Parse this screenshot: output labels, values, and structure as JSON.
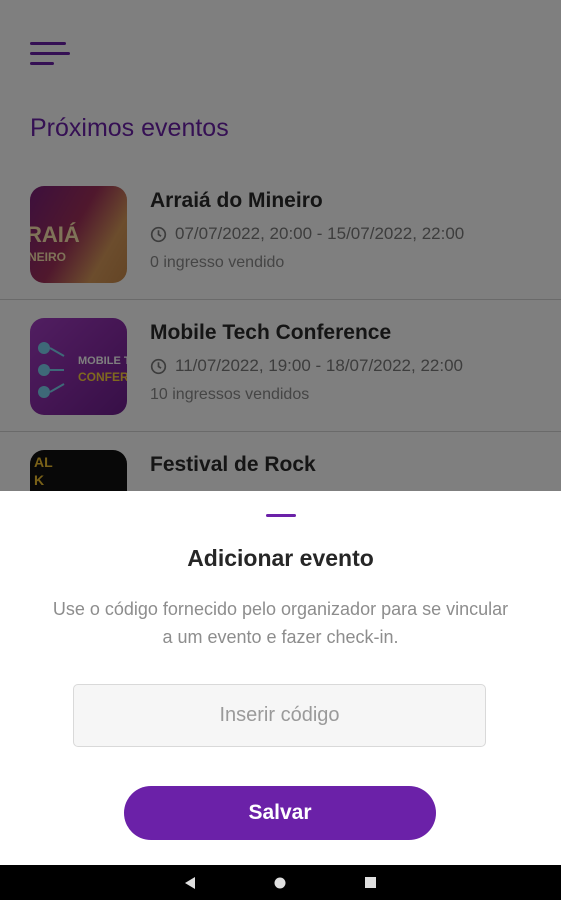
{
  "header": {
    "menu_icon": "menu-icon"
  },
  "section": {
    "title": "Próximos eventos"
  },
  "events": [
    {
      "title": "Arraiá do Mineiro",
      "dates": "07/07/2022, 20:00 - 15/07/2022, 22:00",
      "sold": "0 ingresso vendido",
      "thumb_text": [
        "RAIÁ",
        "NEIRO"
      ]
    },
    {
      "title": "Mobile Tech Conference",
      "dates": "11/07/2022, 19:00 - 18/07/2022, 22:00",
      "sold": "10 ingressos vendidos",
      "thumb_text": [
        "MOBILE T",
        "CONFER"
      ]
    },
    {
      "title": "Festival de Rock",
      "thumb_text": [
        "AL",
        "K"
      ]
    }
  ],
  "sheet": {
    "title": "Adicionar evento",
    "description": "Use o código fornecido pelo organizador para se vincular a um evento e fazer check-in.",
    "code_placeholder": "Inserir código",
    "save_label": "Salvar"
  },
  "colors": {
    "accent": "#6b21a8",
    "scrim": "rgba(0,0,0,0.5)"
  }
}
